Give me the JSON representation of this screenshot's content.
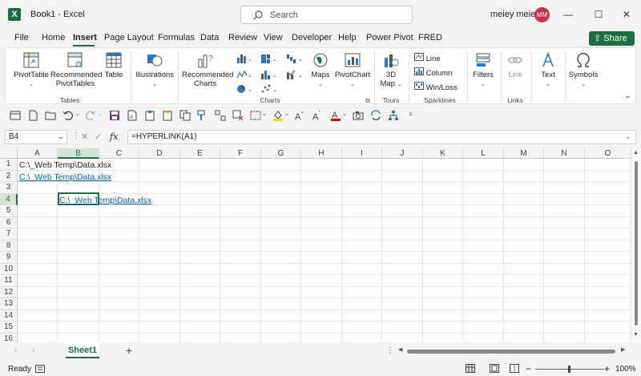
{
  "window": {
    "doc_title": "Book1  -  Excel",
    "search_placeholder": "Search",
    "user_name": "meiey meiey",
    "user_initials": "MM",
    "minimize": "—",
    "maximize": "☐",
    "close": "✕"
  },
  "menu": {
    "tabs": [
      "File",
      "Home",
      "Insert",
      "Page Layout",
      "Formulas",
      "Data",
      "Review",
      "View",
      "Developer",
      "Help",
      "Power Pivot",
      "FRED"
    ],
    "active": "Insert",
    "share_label": "Share"
  },
  "ribbon": {
    "pivottable": "PivotTable",
    "rec_pivot_1": "Recommended",
    "rec_pivot_2": "PivotTables",
    "table": "Table",
    "tables_group": "Tables",
    "illustrations": "Illustrations",
    "rec_charts_1": "Recommended",
    "rec_charts_2": "Charts",
    "maps": "Maps",
    "pivotchart": "PivotChart",
    "charts_group": "Charts",
    "map3d_1": "3D",
    "map3d_2": "Map",
    "tours_group": "Tours",
    "spark_line": "Line",
    "spark_column": "Column",
    "spark_winloss": "Win/Loss",
    "sparklines_group": "Sparklines",
    "filters": "Filters",
    "link": "Link",
    "links_group": "Links",
    "text": "Text",
    "symbols": "Symbols"
  },
  "formula_bar": {
    "name_box": "B4",
    "fx": "fx",
    "formula": "=HYPERLINK(A1)"
  },
  "grid": {
    "columns": [
      "A",
      "B",
      "C",
      "D",
      "E",
      "F",
      "G",
      "H",
      "I",
      "J",
      "K",
      "L",
      "M",
      "N",
      "O"
    ],
    "rows": [
      "1",
      "2",
      "3",
      "4",
      "5",
      "6",
      "7",
      "8",
      "9",
      "10",
      "11",
      "12",
      "13",
      "14",
      "15",
      "16"
    ],
    "a1": "C:\\_Web Temp\\Data.xlsx",
    "a2": "C:\\_Web Temp\\Data.xlsx",
    "b4": "C:\\_Web Temp\\Data.xlsx"
  },
  "sheets": {
    "tabs": [
      "Sheet1"
    ],
    "add": "+"
  },
  "status": {
    "ready": "Ready",
    "zoom": "100%",
    "minus": "−",
    "plus": "+"
  }
}
